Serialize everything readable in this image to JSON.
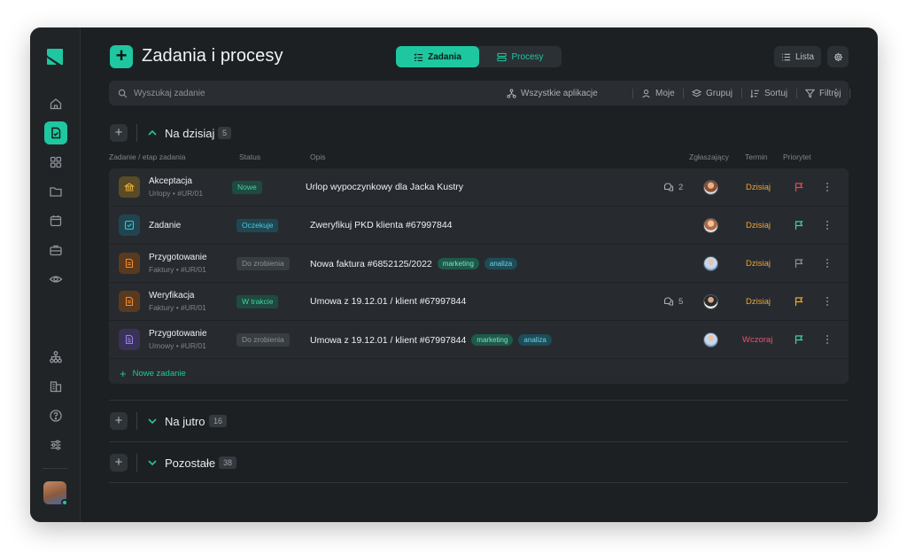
{
  "app": {
    "title": "Zadania i procesy",
    "accent": "#1ec7a0"
  },
  "sidebar": {
    "logo": "logo-mark",
    "items": [
      {
        "icon": "home-icon",
        "active": false
      },
      {
        "icon": "task-icon",
        "active": true
      },
      {
        "icon": "grid-icon",
        "active": false
      },
      {
        "icon": "folder-icon",
        "active": false
      },
      {
        "icon": "calendar-icon",
        "active": false
      },
      {
        "icon": "briefcase-icon",
        "active": false
      },
      {
        "icon": "eye-icon",
        "active": false
      }
    ],
    "bottom_items": [
      {
        "icon": "hierarchy-icon"
      },
      {
        "icon": "buildings-icon"
      },
      {
        "icon": "help-icon"
      },
      {
        "icon": "sliders-icon"
      }
    ]
  },
  "tabs": {
    "zadania": "Zadania",
    "procesy": "Procesy"
  },
  "header": {
    "list_label": "Lista",
    "settings_icon": "gear-icon"
  },
  "toolbar": {
    "search_placeholder": "Wyszukaj zadanie",
    "all_apps": "Wszystkie aplikacje",
    "mine": "Moje",
    "group": "Grupuj",
    "sort": "Sortuj",
    "filter": "Filtruj"
  },
  "groups": [
    {
      "title": "Na dzisiaj",
      "count": "5",
      "expanded": true
    },
    {
      "title": "Na jutro",
      "count": "16",
      "expanded": false
    },
    {
      "title": "Pozostałe",
      "count": "38",
      "expanded": false
    }
  ],
  "columns": {
    "task": "Zadanie / etap zadania",
    "status": "Status",
    "description": "Opis",
    "reporter": "Zgłaszający",
    "deadline": "Termin",
    "priority": "Priorytet"
  },
  "rows": [
    {
      "icon": "bank-icon",
      "icon_color": "#e8b23a",
      "icon_bg": "#5a4a25",
      "name": "Akceptacja",
      "sub": "Urlopy  •  #UR/01",
      "status": "Nowe",
      "status_color": "#3fd1a5",
      "status_bg": "#1f4a3f",
      "desc": "Urlop wypoczynkowy dla Jacka Kustry",
      "tags": [],
      "comments": "2",
      "deadline": "Dzisiaj",
      "deadline_color": "#f0a531",
      "priority_color": "#e8474f"
    },
    {
      "icon": "checkbox-icon",
      "icon_color": "#3fc3d8",
      "icon_bg": "#1f4550",
      "name": "Zadanie",
      "sub": "",
      "status": "Oczekuje",
      "status_color": "#4fc8e0",
      "status_bg": "#1f4752",
      "desc": "Zweryfikuj PKD klienta #67997844",
      "tags": [],
      "comments": "",
      "deadline": "Dzisiaj",
      "deadline_color": "#f0a531",
      "priority_color": "#3fd1a5"
    },
    {
      "icon": "document-icon",
      "icon_color": "#ef8a2e",
      "icon_bg": "#5a3a1f",
      "name": "Przygotowanie",
      "sub": "Faktury  •  #UR/01",
      "status": "Do zrobienia",
      "status_color": "#8a9096",
      "status_bg": "#383d42",
      "desc": "Nowa faktura #6852125/2022",
      "tags": [
        "marketing",
        "analiza"
      ],
      "comments": "",
      "deadline": "Dzisiaj",
      "deadline_color": "#f0a531",
      "priority_color": "#8a9096"
    },
    {
      "icon": "document-icon",
      "icon_color": "#ef8a2e",
      "icon_bg": "#5a3a1f",
      "name": "Weryfikacja",
      "sub": "Faktury  •  #UR/01",
      "status": "W trakcie",
      "status_color": "#3fd1a5",
      "status_bg": "#1f4a3f",
      "desc": "Umowa z 19.12.01 / klient #67997844",
      "tags": [],
      "comments": "5",
      "deadline": "Dzisiaj",
      "deadline_color": "#f0a531",
      "priority_color": "#f0a531"
    },
    {
      "icon": "contract-icon",
      "icon_color": "#9a7cf0",
      "icon_bg": "#3a3258",
      "name": "Przygotowanie",
      "sub": "Umowy  •  #UR/01",
      "status": "Do zrobienia",
      "status_color": "#8a9096",
      "status_bg": "#383d42",
      "desc": "Umowa z 19.12.01 / klient #67997844",
      "tags": [
        "marketing",
        "analiza"
      ],
      "comments": "",
      "deadline": "Wczoraj",
      "deadline_color": "#ee4f6b",
      "priority_color": "#3fd1a5"
    }
  ],
  "new_task": "Nowe zadanie"
}
